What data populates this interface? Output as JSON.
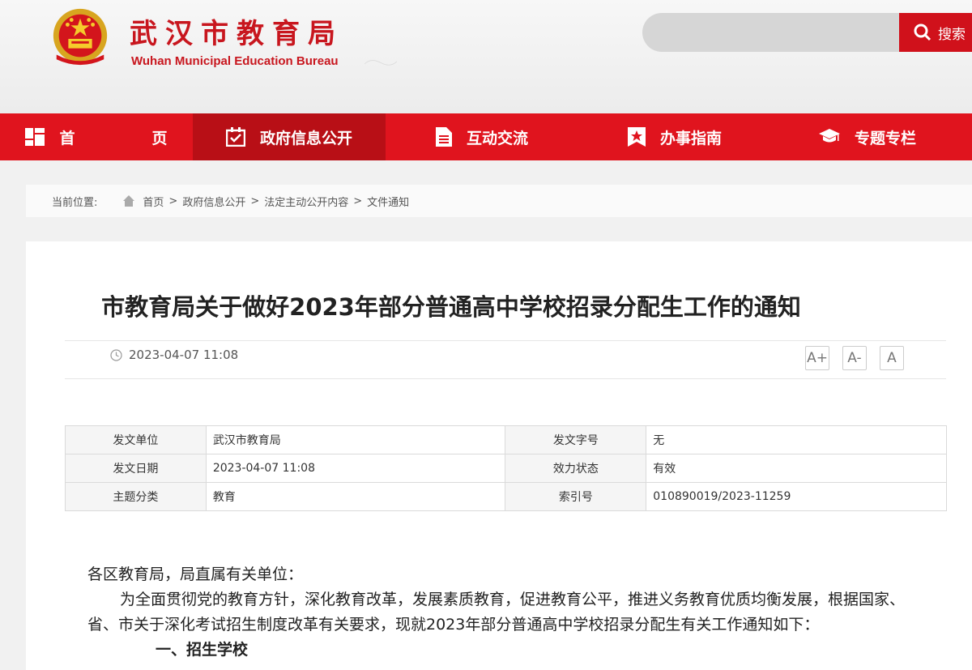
{
  "header": {
    "title": "武汉市教育局",
    "subtitle": "Wuhan Municipal Education Bureau",
    "search_placeholder": "",
    "search_label": "搜索",
    "brand_color": "#d0111b"
  },
  "nav": {
    "items": [
      {
        "label": "首　页",
        "icon": "home-grid-icon"
      },
      {
        "label": "政府信息公开",
        "icon": "calendar-check-icon"
      },
      {
        "label": "互动交流",
        "icon": "document-icon"
      },
      {
        "label": "办事指南",
        "icon": "bookmark-star-icon"
      },
      {
        "label": "专题专栏",
        "icon": "graduation-cap-icon"
      }
    ],
    "active_index": 1
  },
  "breadcrumb": {
    "label": "当前位置:",
    "items": [
      "首页",
      "政府信息公开",
      "法定主动公开内容",
      "文件通知"
    ],
    "separator": ">"
  },
  "article": {
    "title": "市教育局关于做好2023年部分普通高中学校招录分配生工作的通知",
    "date": "2023-04-07 11:08",
    "font_sizes": [
      "A+",
      "A-",
      "A"
    ]
  },
  "info_table": {
    "rows": [
      {
        "k1": "发文单位",
        "v1": "武汉市教育局",
        "k2": "发文字号",
        "v2": "无"
      },
      {
        "k1": "发文日期",
        "v1": "2023-04-07 11:08",
        "k2": "效力状态",
        "v2": "有效"
      },
      {
        "k1": "主题分类",
        "v1": "教育",
        "k2": "索引号",
        "v2": "010890019/2023-11259"
      }
    ]
  },
  "body": {
    "salutation": "各区教育局，局直属有关单位：",
    "paragraph": "为全面贯彻党的教育方针，深化教育改革，发展素质教育，促进教育公平，推进义务教育优质均衡发展，根据国家、省、市关于深化考试招生制度改革有关要求，现就2023年部分普通高中学校招录分配生有关工作通知如下：",
    "section_head": "一、招生学校"
  }
}
